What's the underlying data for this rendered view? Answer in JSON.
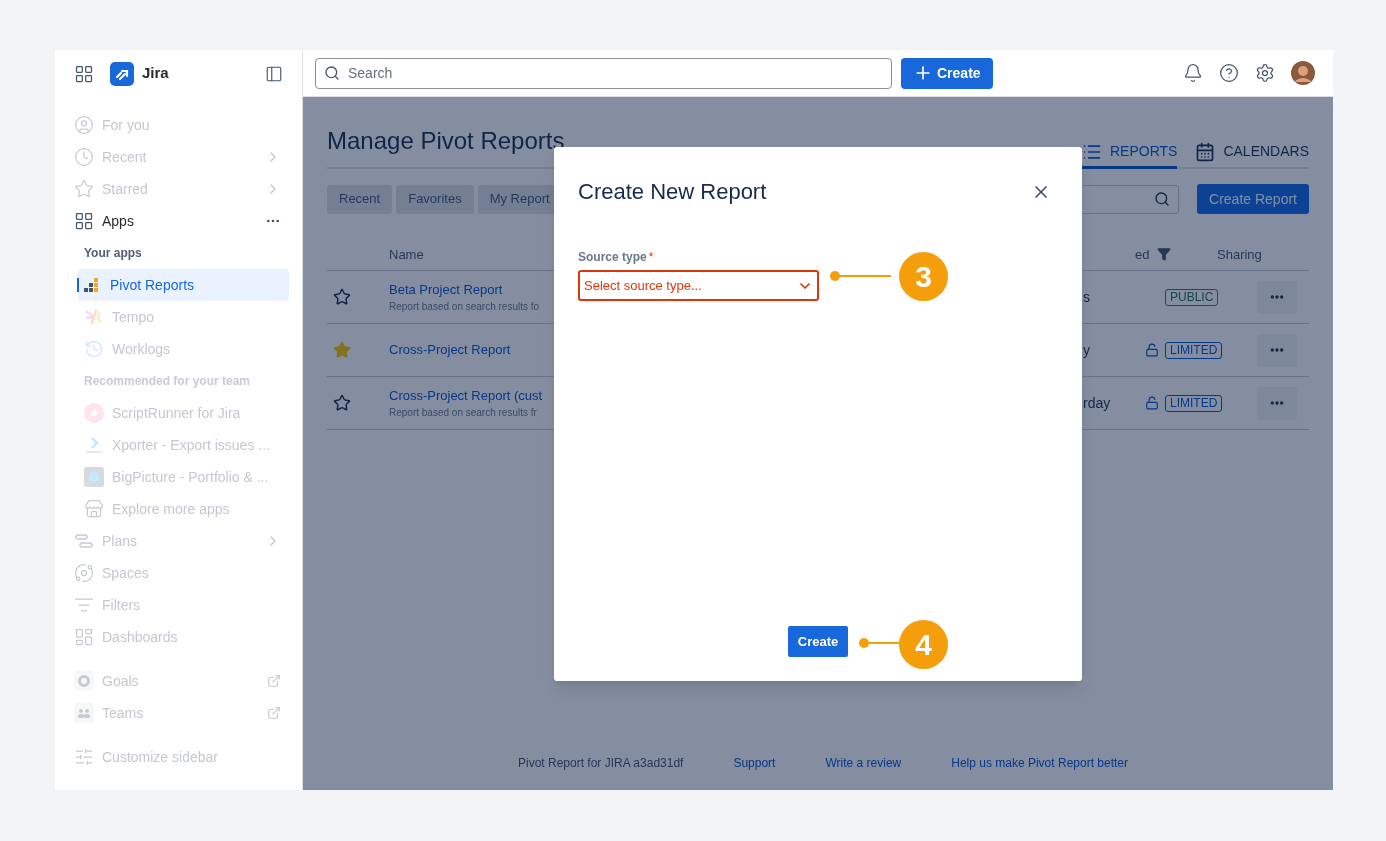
{
  "app": {
    "name": "Jira"
  },
  "search": {
    "placeholder": "Search"
  },
  "create_button": "Create",
  "sidebar": {
    "groups": [
      [
        {
          "label": "For you",
          "kind": "nav",
          "dimmed": true,
          "selected": false
        },
        {
          "label": "Recent",
          "kind": "nav",
          "dimmed": true,
          "selected": false
        },
        {
          "label": "Starred",
          "kind": "nav",
          "dimmed": true,
          "selected": false
        },
        {
          "label": "Apps",
          "kind": "nav",
          "dimmed": false,
          "selected": false
        },
        {
          "label": "Your apps",
          "kind": "heading",
          "dimmed": false
        },
        {
          "label": "Pivot Reports",
          "kind": "app",
          "dimmed": false,
          "selected": true
        },
        {
          "label": "Tempo",
          "kind": "app",
          "dimmed": true,
          "selected": false
        },
        {
          "label": "Worklogs",
          "kind": "app",
          "dimmed": true,
          "selected": false
        },
        {
          "label": "Recommended for your team",
          "kind": "heading",
          "dimmed": true
        },
        {
          "label": "ScriptRunner for Jira",
          "kind": "app",
          "dimmed": true,
          "selected": false
        },
        {
          "label": "Xporter - Export issues ...",
          "kind": "app",
          "dimmed": true,
          "selected": false
        },
        {
          "label": "BigPicture - Portfolio & ...",
          "kind": "app",
          "dimmed": true,
          "selected": false
        },
        {
          "label": "Explore more apps",
          "kind": "app",
          "dimmed": true,
          "selected": false
        },
        {
          "label": "Plans",
          "kind": "nav",
          "dimmed": true,
          "selected": false
        },
        {
          "label": "Spaces",
          "kind": "nav",
          "dimmed": true,
          "selected": false
        },
        {
          "label": "Filters",
          "kind": "nav",
          "dimmed": true,
          "selected": false
        },
        {
          "label": "Dashboards",
          "kind": "nav",
          "dimmed": true,
          "selected": false
        }
      ],
      [
        {
          "label": "Goals",
          "kind": "nav",
          "dimmed": true,
          "selected": false
        },
        {
          "label": "Teams",
          "kind": "nav",
          "dimmed": true,
          "selected": false
        }
      ],
      [
        {
          "label": "Customize sidebar",
          "kind": "nav",
          "dimmed": true,
          "selected": false
        }
      ]
    ]
  },
  "page": {
    "title": "Manage Pivot Reports",
    "view_tabs": [
      {
        "label": "REPORTS",
        "selected": true
      },
      {
        "label": "CALENDARS",
        "selected": false
      }
    ],
    "filter_chips": [
      "Recent",
      "Favorites",
      "My Report"
    ],
    "create_report_button": "Create Report",
    "table": {
      "columns": [
        "Name",
        "ed",
        "Sharing"
      ],
      "rows": [
        {
          "starred": false,
          "name": "Beta Project Report",
          "description": "Report based on search results fo",
          "modified": "s",
          "locked": false,
          "sharing": {
            "label": "PUBLIC",
            "kind": "public"
          }
        },
        {
          "starred": true,
          "name": "Cross-Project Report",
          "modified": "y",
          "locked": true,
          "sharing": {
            "label": "LIMITED",
            "kind": "limited"
          }
        },
        {
          "starred": false,
          "name": "Cross-Project Report (cust",
          "description": "Report based on search results fr",
          "modified": "rday",
          "locked": true,
          "sharing": {
            "label": "LIMITED",
            "kind": "limited"
          }
        }
      ]
    },
    "footer": {
      "version": "Pivot Report for JIRA a3ad31df",
      "links": [
        "Support",
        "Write a review",
        "Help us make Pivot Report better"
      ]
    }
  },
  "modal": {
    "title": "Create New Report",
    "field": {
      "label": "Source type",
      "required_mark": "*",
      "invalid": true,
      "placeholder": "Select source type..."
    },
    "submit_button": "Create"
  },
  "callouts": [
    {
      "number": "3"
    },
    {
      "number": "4"
    }
  ]
}
